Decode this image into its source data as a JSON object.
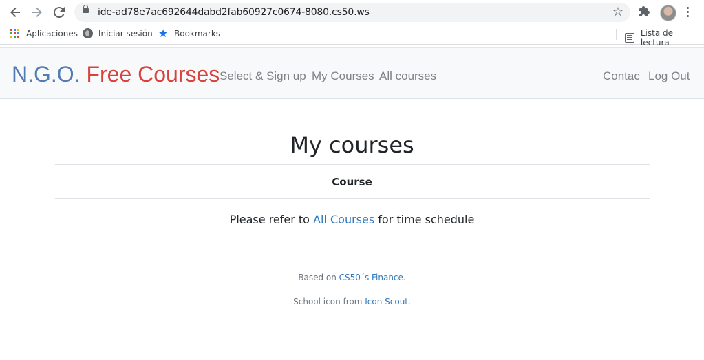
{
  "browser": {
    "url": "ide-ad78e7ac692644dabd2fab60927c0674-8080.cs50.ws",
    "bookmarks": {
      "apps": "Aplicaciones",
      "signin": "Iniciar sesión",
      "bookmarks": "Bookmarks",
      "reading_list": "Lista de lectura"
    }
  },
  "navbar": {
    "brand_part1": "N.G.O.",
    "brand_part2": "Free Courses",
    "links": [
      "Select & Sign up",
      "My Courses",
      "All courses"
    ],
    "right_links": [
      "Contac",
      "Log Out"
    ]
  },
  "main": {
    "title": "My courses",
    "table_header": "Course",
    "refer_prefix": "Please refer to",
    "refer_link": "All Courses",
    "refer_suffix": "for time schedule"
  },
  "footer": {
    "line1_prefix": "Based on",
    "line1_link": "CS50´s Finance",
    "line1_suffix": ".",
    "line2_prefix": "School icon from",
    "line2_link": "Icon Scout",
    "line2_suffix": "."
  },
  "colors": {
    "brand_blue": "#537bb4",
    "brand_red": "#d9413c",
    "link": "#2e79bf",
    "navbar_bg": "#f8f9fa"
  },
  "icons": [
    "back-arrow-icon",
    "forward-arrow-icon",
    "reload-icon",
    "lock-icon",
    "star-icon",
    "puzzle-icon",
    "kebab-menu-icon",
    "apps-grid-icon",
    "globe-icon",
    "bookmark-star-icon",
    "reading-list-icon"
  ]
}
